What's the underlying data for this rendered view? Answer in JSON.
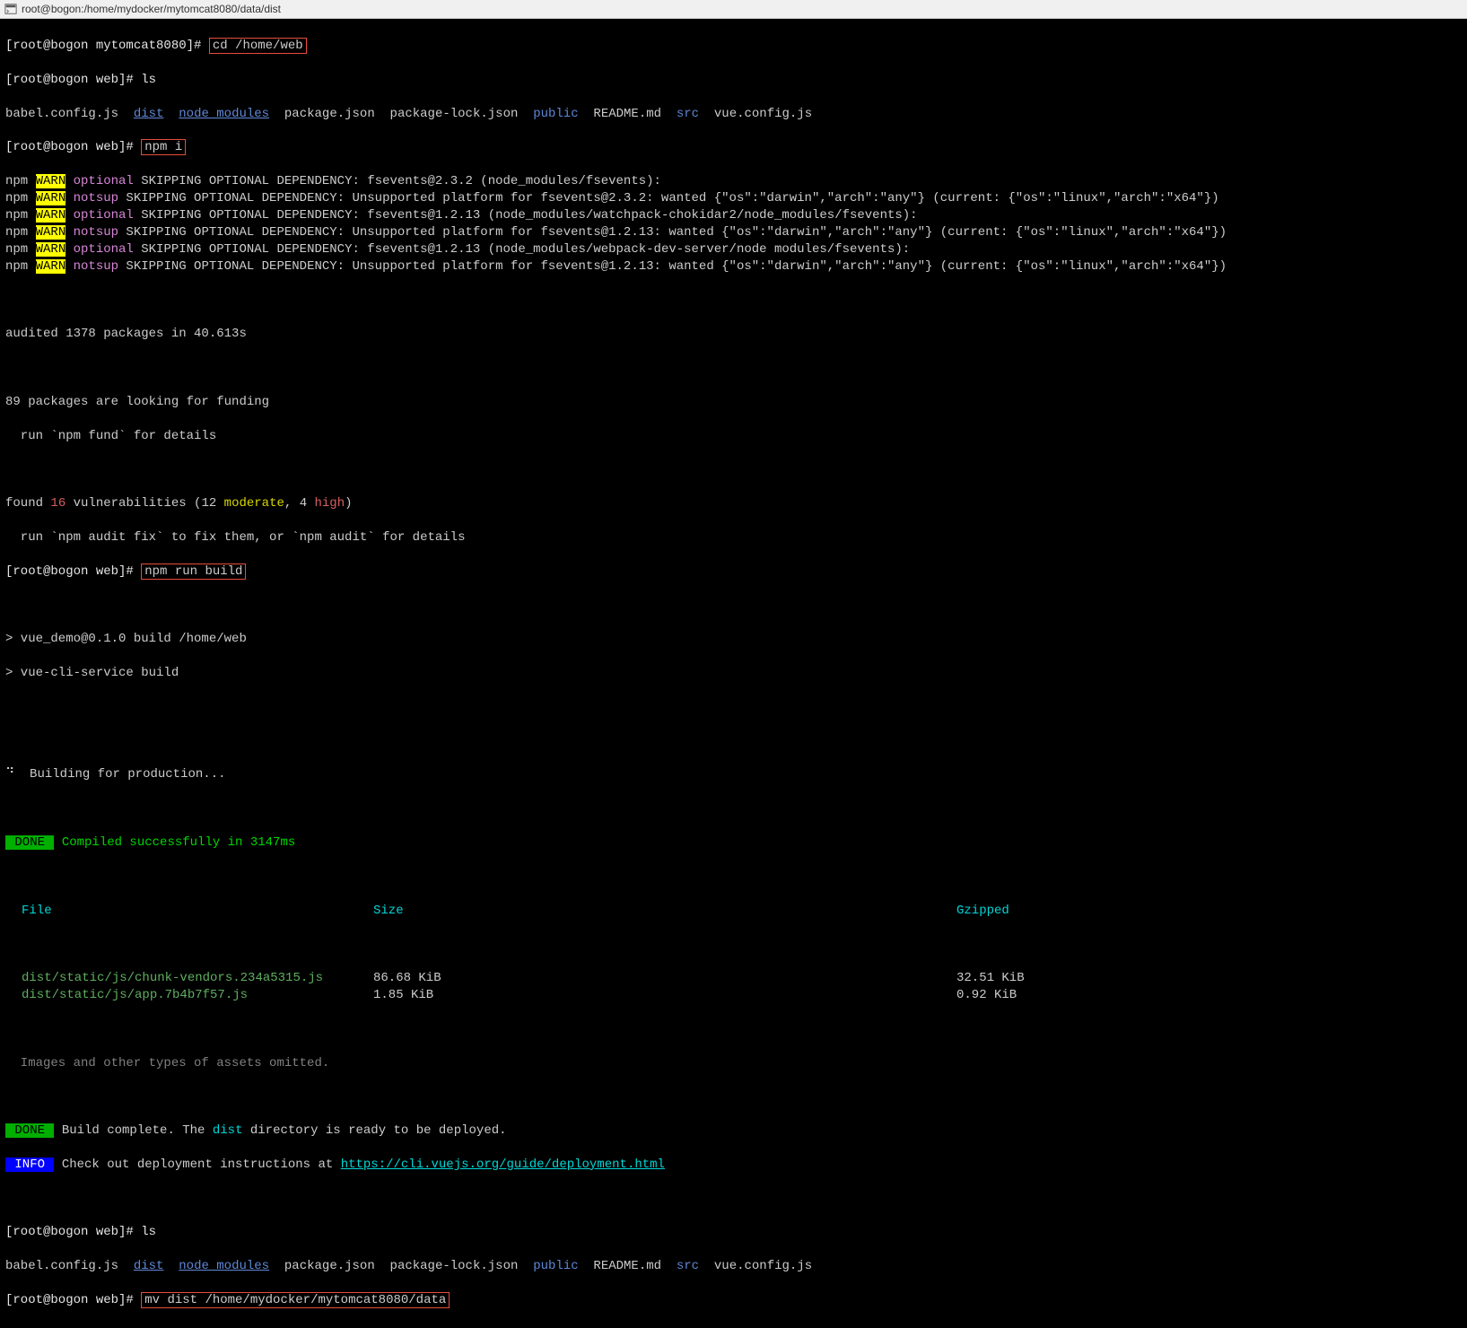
{
  "title_bar": {
    "text": "root@bogon:/home/mydocker/mytomcat8080/data/dist"
  },
  "term": {
    "prompt1": "[root@bogon mytomcat8080]# ",
    "cmd1": "cd /home/web",
    "prompt2": "[root@bogon web]# ls",
    "ls_row1": {
      "f1": "babel.config.js",
      "dist": "dist",
      "node_modules": "node_modules",
      "pkg": "package.json",
      "pkglock": "package-lock.json",
      "public": "public",
      "readme": "README.md",
      "src": "src",
      "vuecfg": "vue.config.js"
    },
    "prompt3": "[root@bogon web]# ",
    "cmd3": "npm i",
    "npm_lines": [
      {
        "pre": "npm ",
        "warn": "WARN",
        "tag": " optional",
        "rest": " SKIPPING OPTIONAL DEPENDENCY: fsevents@2.3.2 (node_modules/fsevents):"
      },
      {
        "pre": "npm ",
        "warn": "WARN",
        "tag": " notsup",
        "rest": " SKIPPING OPTIONAL DEPENDENCY: Unsupported platform for fsevents@2.3.2: wanted {\"os\":\"darwin\",\"arch\":\"any\"} (current: {\"os\":\"linux\",\"arch\":\"x64\"})"
      },
      {
        "pre": "npm ",
        "warn": "WARN",
        "tag": " optional",
        "rest": " SKIPPING OPTIONAL DEPENDENCY: fsevents@1.2.13 (node_modules/watchpack-chokidar2/node_modules/fsevents):"
      },
      {
        "pre": "npm ",
        "warn": "WARN",
        "tag": " notsup",
        "rest": " SKIPPING OPTIONAL DEPENDENCY: Unsupported platform for fsevents@1.2.13: wanted {\"os\":\"darwin\",\"arch\":\"any\"} (current: {\"os\":\"linux\",\"arch\":\"x64\"})"
      },
      {
        "pre": "npm ",
        "warn": "WARN",
        "tag": " optional",
        "rest": " SKIPPING OPTIONAL DEPENDENCY: fsevents@1.2.13 (node_modules/webpack-dev-server/node modules/fsevents):"
      },
      {
        "pre": "npm ",
        "warn": "WARN",
        "tag": " notsup",
        "rest": " SKIPPING OPTIONAL DEPENDENCY: Unsupported platform for fsevents@1.2.13: wanted {\"os\":\"darwin\",\"arch\":\"any\"} (current: {\"os\":\"linux\",\"arch\":\"x64\"})"
      }
    ],
    "audited": "audited 1378 packages in 40.613s",
    "funding1": "89 packages are looking for funding",
    "funding2": "  run `npm fund` for details",
    "vuln": {
      "pre": "found ",
      "num": "16",
      "mid": " vulnerabilities (12 ",
      "mod": "moderate",
      "mid2": ", 4 ",
      "high": "high",
      "end": ")"
    },
    "audit_fix": "  run `npm audit fix` to fix them, or `npm audit` for details",
    "prompt4": "[root@bogon web]# ",
    "cmd4": "npm run build",
    "build1": "> vue_demo@0.1.0 build /home/web",
    "build2": "> vue-cli-service build",
    "building": "⠙  Building for production...",
    "done1": " DONE ",
    "compiled": " Compiled successfully in 3147ms",
    "table_header": {
      "file": "File",
      "size": "Size",
      "gzip": "Gzipped"
    },
    "table_rows": [
      {
        "file": "dist/static/js/chunk-vendors.234a5315.js",
        "size": "86.68 KiB",
        "gzip": "32.51 KiB"
      },
      {
        "file": "dist/static/js/app.7b4b7f57.js",
        "size": "1.85 KiB",
        "gzip": "0.92 KiB"
      }
    ],
    "omitted": "  Images and other types of assets omitted.",
    "done2": " DONE ",
    "build_complete_pre": " Build complete. The ",
    "build_complete_dist": "dist",
    "build_complete_post": " directory is ready to be deployed.",
    "info": " INFO ",
    "info_text": " Check out deployment instructions at ",
    "info_url": "https://cli.vuejs.org/guide/deployment.html",
    "prompt5": "[root@bogon web]# ls",
    "prompt6": "[root@bogon web]# ",
    "cmd6": "mv dist /home/mydocker/mytomcat8080/data"
  }
}
